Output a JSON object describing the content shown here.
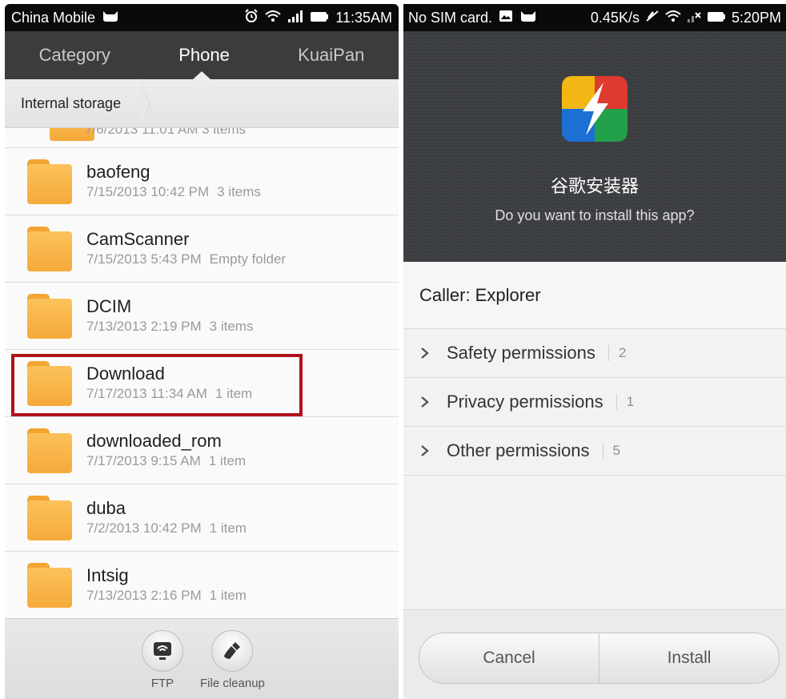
{
  "left": {
    "status": {
      "carrier": "China Mobile",
      "time": "11:35AM"
    },
    "tabs": [
      "Category",
      "Phone",
      "KuaiPan"
    ],
    "breadcrumb": "Internal storage",
    "partial_meta": "7/6/2013 11:01 AM  3 items",
    "files": [
      {
        "name": "baofeng",
        "date": "7/15/2013 10:42 PM",
        "count": "3 items"
      },
      {
        "name": "CamScanner",
        "date": "7/15/2013 5:43 PM",
        "count": "Empty folder"
      },
      {
        "name": "DCIM",
        "date": "7/13/2013 2:19 PM",
        "count": "3 items"
      },
      {
        "name": "Download",
        "date": "7/17/2013 11:34 AM",
        "count": "1 item"
      },
      {
        "name": "downloaded_rom",
        "date": "7/17/2013 9:15 AM",
        "count": "1 item"
      },
      {
        "name": "duba",
        "date": "7/2/2013 10:42 PM",
        "count": "1 item"
      },
      {
        "name": "Intsig",
        "date": "7/13/2013 2:16 PM",
        "count": "1 item"
      }
    ],
    "bottom": {
      "ftp_label": "FTP",
      "cleanup_label": "File cleanup"
    },
    "colors": {
      "folder": "#f6a93a",
      "highlight": "#b0121b"
    }
  },
  "right": {
    "status": {
      "carrier": "No SIM card.",
      "speed": "0.45K/s",
      "time": "5:20PM"
    },
    "app": {
      "name": "谷歌安装器",
      "prompt": "Do you want to install this app?"
    },
    "caller": "Caller: Explorer",
    "permissions": [
      {
        "label": "Safety permissions",
        "count": "2"
      },
      {
        "label": "Privacy permissions",
        "count": "1"
      },
      {
        "label": "Other permissions",
        "count": "5"
      }
    ],
    "buttons": {
      "cancel": "Cancel",
      "install": "Install"
    }
  }
}
